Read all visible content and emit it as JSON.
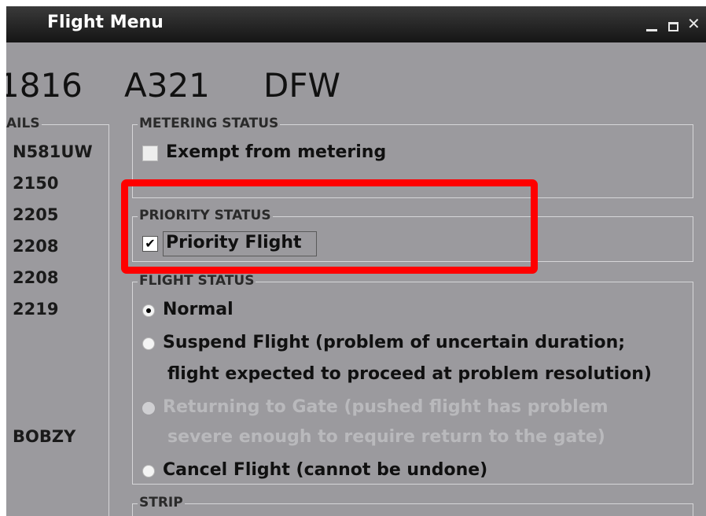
{
  "window": {
    "title": "Flight Menu",
    "minimize_label": "_",
    "close_label": "✕"
  },
  "header": {
    "flight_id": "1816",
    "aircraft_type": "A321",
    "destination": "DFW"
  },
  "details": {
    "label": "AILS",
    "values": [
      "N581UW",
      "2150",
      "2205",
      "2208",
      "2208",
      "2219",
      "BOBZY"
    ]
  },
  "metering": {
    "label": "METERING STATUS",
    "option": "Exempt from metering",
    "checked": false
  },
  "priority": {
    "label": "PRIORITY STATUS",
    "option": "Priority Flight",
    "checked": true
  },
  "flight_status": {
    "label": "FLIGHT STATUS",
    "options": [
      {
        "line1": "Normal",
        "line2": "",
        "selected": true,
        "enabled": true
      },
      {
        "line1": "Suspend Flight (problem of uncertain duration;",
        "line2": "flight expected to proceed at problem resolution)",
        "selected": false,
        "enabled": true
      },
      {
        "line1": "Returning to Gate (pushed flight has problem",
        "line2": "severe enough to require return to the gate)",
        "selected": false,
        "enabled": false
      },
      {
        "line1": "Cancel Flight (cannot be undone)",
        "line2": "",
        "selected": false,
        "enabled": true
      }
    ]
  },
  "strip": {
    "label": "STRIP"
  },
  "colors": {
    "highlight": "#ff0000",
    "background": "#9b9a9e",
    "titlebar": "#1e1e1e"
  }
}
